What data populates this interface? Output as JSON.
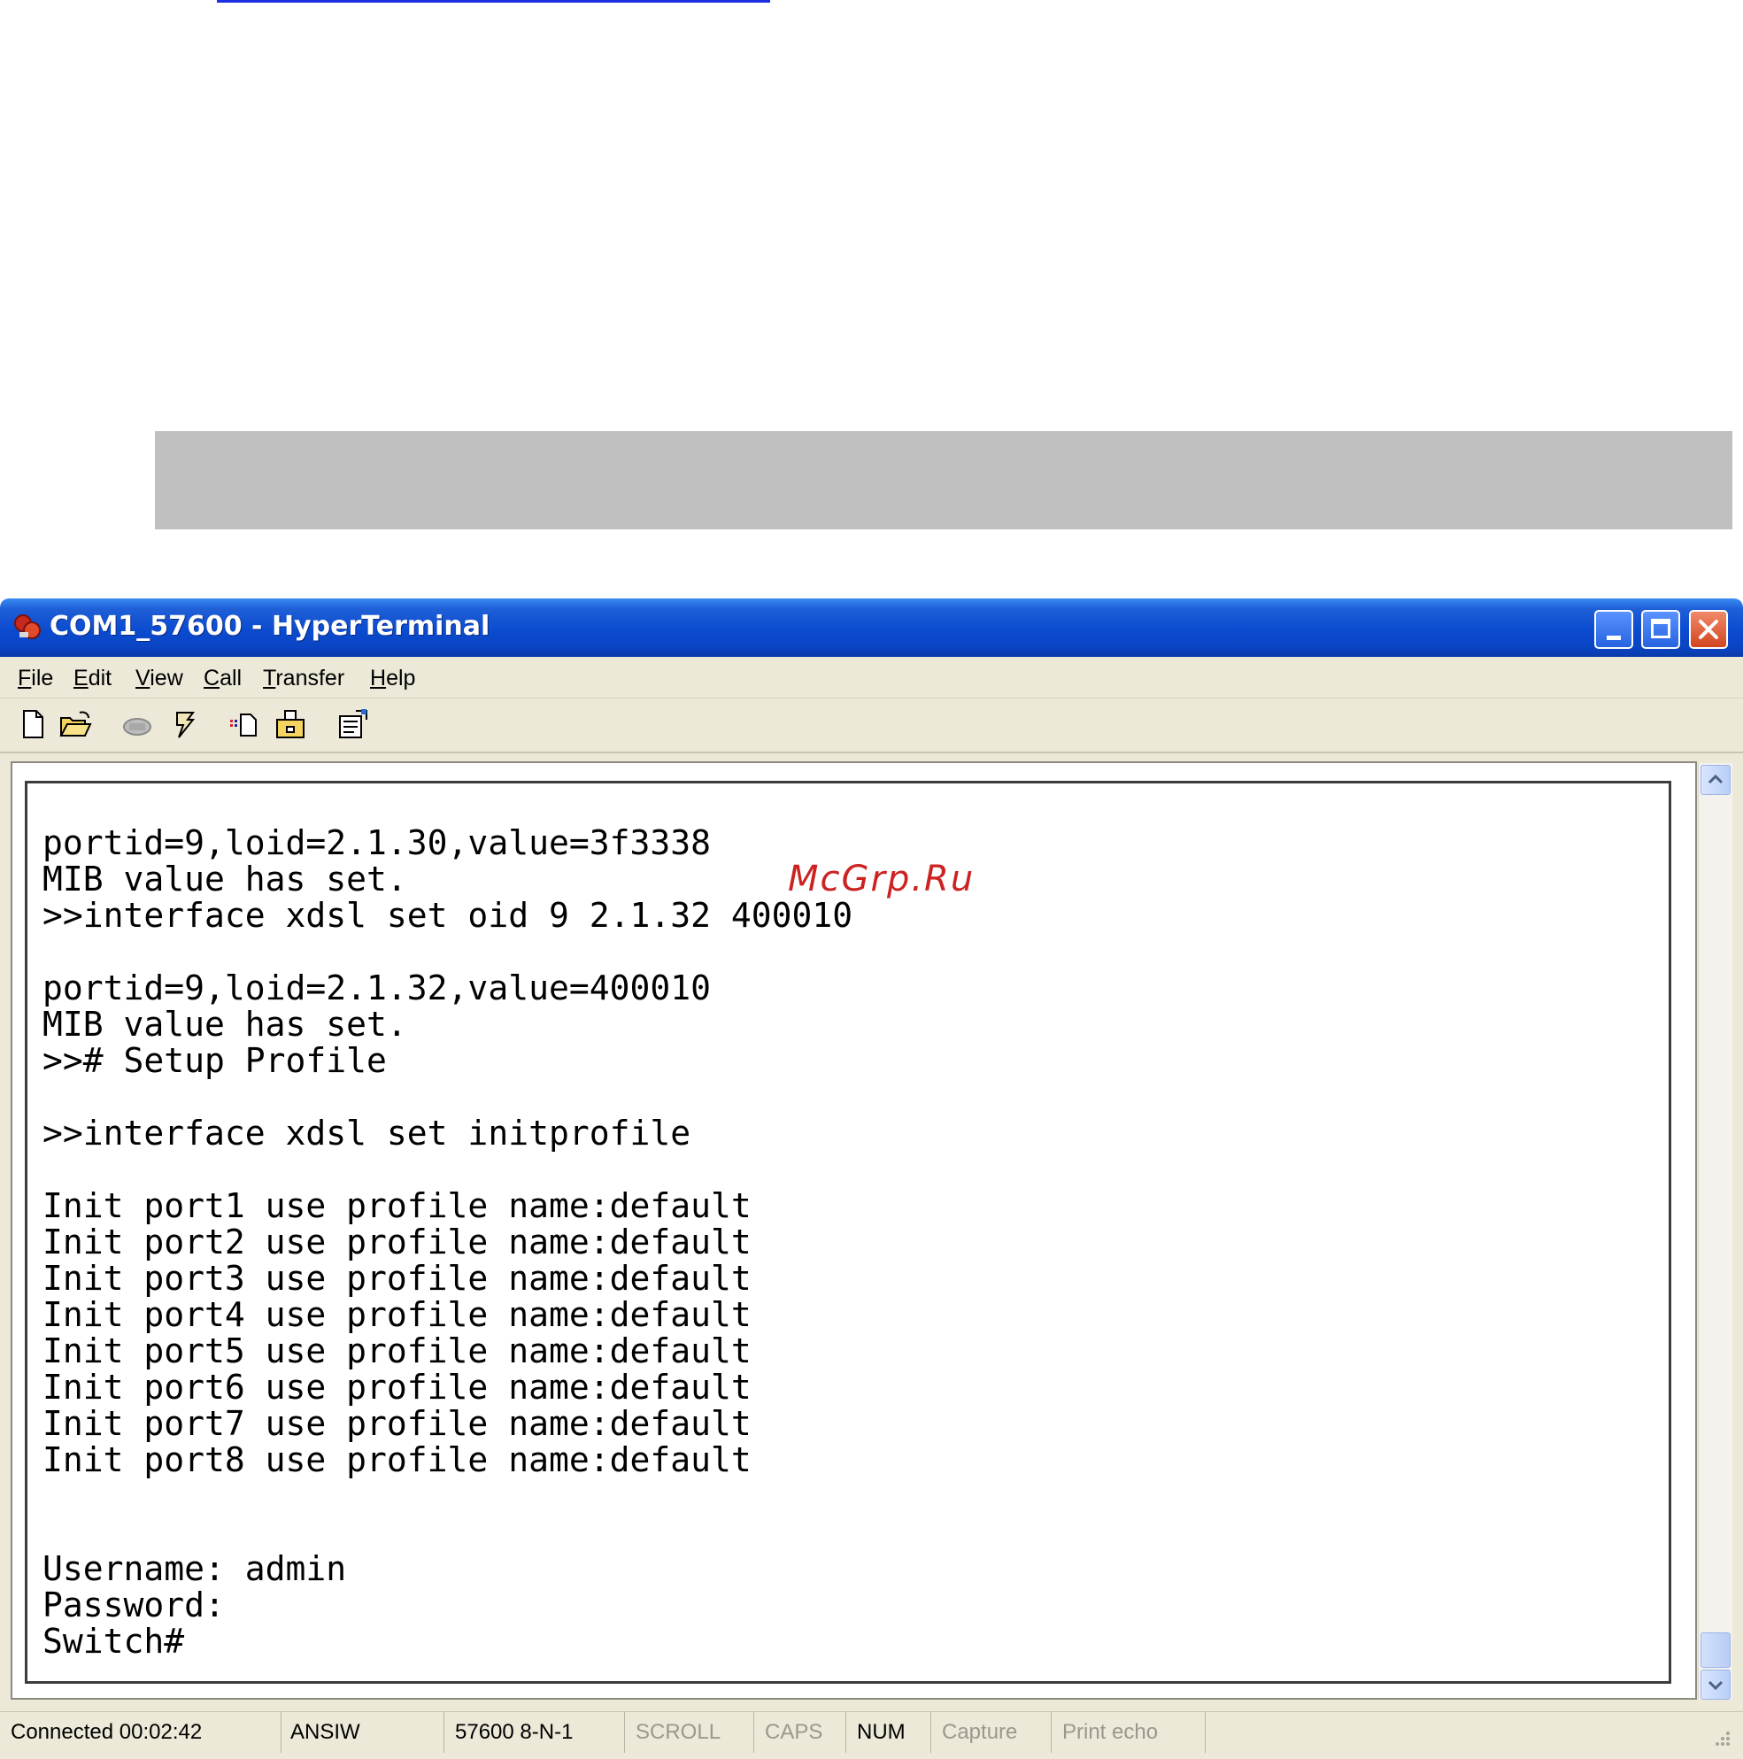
{
  "window": {
    "title": "COM1_57600 - HyperTerminal"
  },
  "menu": [
    "File",
    "Edit",
    "View",
    "Call",
    "Transfer",
    "Help"
  ],
  "toolbar": {
    "icons": [
      "new-icon",
      "open-icon",
      "disconnect-icon",
      "call-icon",
      "send-icon",
      "receive-icon",
      "properties-icon"
    ]
  },
  "watermark": "McGrp.Ru",
  "terminal": {
    "lines": [
      "portid=9,loid=2.1.30,value=3f3338",
      "MIB value has set.",
      ">>interface xdsl set oid 9 2.1.32 400010",
      "",
      "portid=9,loid=2.1.32,value=400010",
      "MIB value has set.",
      ">># Setup Profile",
      "",
      ">>interface xdsl set initprofile",
      "",
      "Init port1 use profile name:default",
      "Init port2 use profile name:default",
      "Init port3 use profile name:default",
      "Init port4 use profile name:default",
      "Init port5 use profile name:default",
      "Init port6 use profile name:default",
      "Init port7 use profile name:default",
      "Init port8 use profile name:default",
      "",
      "",
      "Username: admin",
      "Password:",
      "Switch#"
    ]
  },
  "status": {
    "connected": "Connected 00:02:42",
    "emulation": "ANSIW",
    "port_settings": "57600 8-N-1",
    "scroll": "SCROLL",
    "caps": "CAPS",
    "num": "NUM",
    "capture": "Capture",
    "print_echo": "Print echo"
  }
}
